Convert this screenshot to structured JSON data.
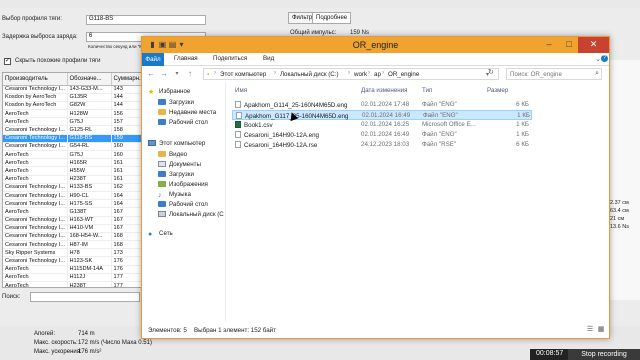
{
  "background_app": {
    "profile_label": "Выбор профиля тяги:",
    "profile_value": "G118-BS",
    "delay_label": "Задержка выброса заряда:",
    "delay_value": "6",
    "hint_text": "Количество секунд или \"Max\"",
    "checkbox_label": "Скрыть похожие профили тяги",
    "columns": [
      "Производитель",
      "Обозначе...",
      "Суммарн..."
    ],
    "rows": [
      [
        "Cesaroni Technology I...",
        "143-G33-M...",
        "143"
      ],
      [
        "Kosdon by AeroTech",
        "G135R",
        "144"
      ],
      [
        "Kosdon by AeroTech",
        "G82W",
        "144"
      ],
      [
        "AeroTech",
        "H128W",
        "156"
      ],
      [
        "AeroTech",
        "G75J",
        "157"
      ],
      [
        "Cesaroni Technology I...",
        "G125-RL",
        "158"
      ],
      [
        "Cesaroni Technology I...",
        "G118-BS",
        "159"
      ],
      [
        "Cesaroni Technology I...",
        "G54-RL",
        "160"
      ],
      [
        "AeroTech",
        "G75J",
        "160"
      ],
      [
        "AeroTech",
        "H165R",
        "161"
      ],
      [
        "AeroTech",
        "H55W",
        "161"
      ],
      [
        "AeroTech",
        "H238T",
        "161"
      ],
      [
        "Cesaroni Technology I...",
        "H133-BS",
        "162"
      ],
      [
        "Cesaroni Technology I...",
        "H90-CL",
        "164"
      ],
      [
        "Cesaroni Technology I...",
        "H175-SS",
        "164"
      ],
      [
        "AeroTech",
        "G138T",
        "167"
      ],
      [
        "Cesaroni Technology I...",
        "H163-WT",
        "167"
      ],
      [
        "Cesaroni Technology I...",
        "H410-VM",
        "167"
      ],
      [
        "Cesaroni Technology I...",
        "168-H54-W...",
        "168"
      ],
      [
        "Cesaroni Technology I...",
        "H87-IM",
        "168"
      ],
      [
        "Sky Ripper Systems",
        "H78",
        "173"
      ],
      [
        "Cesaroni Technology I...",
        "H123-SK",
        "176"
      ],
      [
        "AeroTech",
        "H115DM-14A",
        "176"
      ],
      [
        "AeroTech",
        "H112J",
        "177"
      ],
      [
        "AeroTech",
        "H238T",
        "177"
      ]
    ],
    "search_label": "Поиск:",
    "tabs": [
      "Фильтр",
      "Подробнее"
    ],
    "total_impulse_label": "Общий импульс:",
    "total_impulse_value": "159 Ns",
    "measurements": [
      "2.37 см",
      "63.4 см",
      "21 см",
      "13.6 Ns"
    ],
    "stats": [
      {
        "label": "Апогей:",
        "value": "714 m"
      },
      {
        "label": "Макс. скорость:",
        "value": "172 m/s  (Число Маха 0.51)"
      },
      {
        "label": "Макс. ускорения:",
        "value": "176 m/s²"
      }
    ]
  },
  "recorder": {
    "time": "00:08:57",
    "stop_label": "Stop recording"
  },
  "explorer": {
    "title": "OR_engine",
    "ribbon_tabs": [
      "Файл",
      "Главная",
      "Поделиться",
      "Вид"
    ],
    "address": [
      "Этот компьютер",
      "Локальный диск (C:)",
      "work",
      "ap",
      "OR_engine"
    ],
    "search_placeholder": "Поиск: OR_engine",
    "nav": {
      "favorites": "Избранное",
      "fav_items": [
        "Загрузки",
        "Недавние места",
        "Рабочий стол"
      ],
      "computer": "Этот компьютер",
      "pc_items": [
        "Видео",
        "Документы",
        "Загрузки",
        "Изображения",
        "Музыка",
        "Рабочий стол",
        "Локальный диск (C"
      ],
      "network": "Сеть"
    },
    "columns": [
      "Имя",
      "Дата изменения",
      "Тип",
      "Размер"
    ],
    "files": [
      {
        "name": "Apakhom_G114_25-160N4M65D.eng",
        "date": "02.01.2024 17:48",
        "type": "Файл \"ENG\"",
        "size": "6 КБ"
      },
      {
        "name": "Apakhom_G117_25-160N4M65D.eng",
        "date": "02.01.2024 16:49",
        "type": "Файл \"ENG\"",
        "size": "1 КБ"
      },
      {
        "name": "Book1.csv",
        "date": "02.01.2024 16:25",
        "type": "Microsoft Office E...",
        "size": "1 КБ"
      },
      {
        "name": "Cesaroni_164H90-12A.eng",
        "date": "02.01.2024 16:49",
        "type": "Файл \"ENG\"",
        "size": "1 КБ"
      },
      {
        "name": "Cesaroni_164H90-12A.rse",
        "date": "24.12.2023 18:03",
        "type": "Файл \"RSE\"",
        "size": "6 КБ"
      }
    ],
    "status": {
      "count": "Элементов: 5",
      "selected": "Выбран 1 элемент: 152 байт"
    }
  },
  "colors": {
    "accent": "#f0a32f",
    "file_tab": "#1979ca",
    "selection": "#cce8ff"
  }
}
